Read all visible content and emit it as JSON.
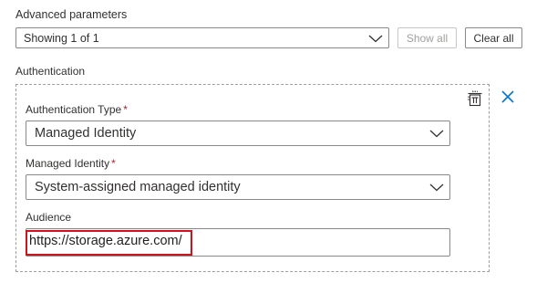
{
  "advanced": {
    "label": "Advanced parameters",
    "filter_value": "Showing 1 of 1",
    "show_all_label": "Show all",
    "clear_all_label": "Clear all"
  },
  "authentication": {
    "section_label": "Authentication",
    "auth_type": {
      "label": "Authentication Type",
      "required_mark": "*",
      "value": "Managed Identity"
    },
    "managed_identity": {
      "label": "Managed Identity",
      "required_mark": "*",
      "value": "System-assigned managed identity"
    },
    "audience": {
      "label": "Audience",
      "value": "https://storage.azure.com/"
    },
    "icons": {
      "delete": "delete-icon",
      "close": "close-icon"
    }
  },
  "colors": {
    "accent": "#0078d4",
    "highlight": "#d0121c",
    "required": "#a4262c"
  }
}
